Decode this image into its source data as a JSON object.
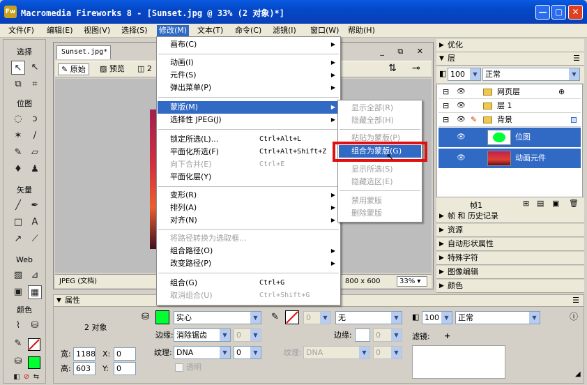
{
  "window": {
    "title": "Macromedia Fireworks 8 - [Sunset.jpg @  33% (2 对象)*]",
    "app_icon": "Fw",
    "minimize": "—",
    "maximize": "▢",
    "close": "✕"
  },
  "menubar": [
    {
      "label": "文件(F)"
    },
    {
      "label": "编辑(E)"
    },
    {
      "label": "视图(V)"
    },
    {
      "label": "选择(S)"
    },
    {
      "label": "修改(M)"
    },
    {
      "label": "文本(T)"
    },
    {
      "label": "命令(C)"
    },
    {
      "label": "滤镜(I)"
    },
    {
      "label": "窗口(W)"
    },
    {
      "label": "帮助(H)"
    }
  ],
  "tools": {
    "sections": [
      "选择",
      "位图",
      "矢量",
      "Web",
      "颜色"
    ]
  },
  "document": {
    "tab": "Sunset.jpg*",
    "view_tabs": [
      "原始",
      "预览",
      "2"
    ],
    "status_left": "JPEG (文档)",
    "size": "800 x 600",
    "zoom": "33%"
  },
  "panels": {
    "optimize": "优化",
    "layers": "层",
    "opacity": "100",
    "blend": "正常",
    "layer_rows": [
      {
        "name": "网页层"
      },
      {
        "name": "层 1"
      },
      {
        "name": "背景"
      }
    ],
    "objects": [
      {
        "name": "位图"
      },
      {
        "name": "动画元件"
      }
    ],
    "frame": "帧1",
    "collapsed": [
      "帧 和 历史记录",
      "资源",
      "自动形状属性",
      "特殊字符",
      "图像编辑",
      "颜色"
    ]
  },
  "properties": {
    "title": "属性",
    "object_count": "2 对象",
    "fill_type": "实心",
    "edge_label": "边缘:",
    "edge_value": "消除锯齿",
    "edge_amount": "0",
    "texture_label": "纹理:",
    "texture_value": "DNA",
    "texture_amount": "0",
    "transparent_label": "透明",
    "stroke_size": "0",
    "stroke_type": "无",
    "stroke_edge_label": "边缘:",
    "stroke_edge_amount": "0",
    "stroke_texture_label": "纹理:",
    "stroke_texture_value": "DNA",
    "stroke_texture_amount": "0",
    "opacity": "100",
    "blend": "正常",
    "filters_label": "滤镜:",
    "add_filter": "+",
    "w_label": "宽:",
    "w_value": "1188",
    "h_label": "高:",
    "h_value": "603",
    "x_label": "X:",
    "x_value": "0",
    "y_label": "Y:",
    "y_value": "0"
  },
  "modify_menu": [
    {
      "label": "画布(C)",
      "shortcut": "",
      "submenu": true,
      "disabled": false
    },
    {
      "label": "动画(I)",
      "shortcut": "",
      "submenu": true,
      "disabled": false
    },
    {
      "label": "元件(S)",
      "shortcut": "",
      "submenu": true,
      "disabled": false
    },
    {
      "label": "弹出菜单(P)",
      "shortcut": "",
      "submenu": true,
      "disabled": false
    },
    {
      "label": "蒙版(M)",
      "shortcut": "",
      "submenu": true,
      "disabled": false,
      "highlight": true
    },
    {
      "label": "选择性 JPEG(J)",
      "shortcut": "",
      "submenu": true,
      "disabled": false
    },
    {
      "label": "锁定所选(L)...",
      "shortcut": "Ctrl+Alt+L",
      "submenu": false,
      "disabled": false
    },
    {
      "label": "平面化所选(F)",
      "shortcut": "Ctrl+Alt+Shift+Z",
      "submenu": false,
      "disabled": false
    },
    {
      "label": "向下合并(E)",
      "shortcut": "Ctrl+E",
      "submenu": false,
      "disabled": true
    },
    {
      "label": "平面化层(Y)",
      "shortcut": "",
      "submenu": false,
      "disabled": false
    },
    {
      "label": "变形(R)",
      "shortcut": "",
      "submenu": true,
      "disabled": false
    },
    {
      "label": "排列(A)",
      "shortcut": "",
      "submenu": true,
      "disabled": false
    },
    {
      "label": "对齐(N)",
      "shortcut": "",
      "submenu": true,
      "disabled": false
    },
    {
      "label": "将路径转换为选取框…",
      "shortcut": "",
      "submenu": false,
      "disabled": true
    },
    {
      "label": "组合路径(O)",
      "shortcut": "",
      "submenu": true,
      "disabled": false
    },
    {
      "label": "改变路径(P)",
      "shortcut": "",
      "submenu": true,
      "disabled": false
    },
    {
      "label": "组合(G)",
      "shortcut": "Ctrl+G",
      "submenu": false,
      "disabled": false
    },
    {
      "label": "取消组合(U)",
      "shortcut": "Ctrl+Shift+G",
      "submenu": false,
      "disabled": true
    }
  ],
  "mask_submenu": [
    {
      "label": "显示全部(R)",
      "disabled": true
    },
    {
      "label": "隐藏全部(H)",
      "disabled": true
    },
    {
      "label": "粘贴为蒙版(P)",
      "disabled": true
    },
    {
      "label": "组合为蒙版(G)",
      "disabled": false,
      "highlight": true
    },
    {
      "label": "显示所选(S)",
      "disabled": true
    },
    {
      "label": "隐藏选区(E)",
      "disabled": true
    },
    {
      "label": "禁用蒙版",
      "disabled": true
    },
    {
      "label": "删除蒙版",
      "disabled": true
    }
  ],
  "colors": {
    "highlight": "#316ac5",
    "fill_swatch": "#00ff33",
    "callout": "#e01010"
  }
}
